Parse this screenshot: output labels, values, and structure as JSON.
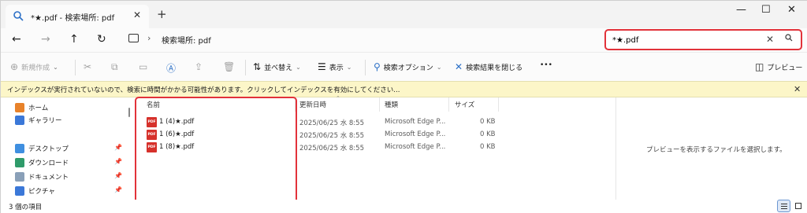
{
  "tab": {
    "title": "*★.pdf - 検索場所: pdf",
    "icon": "search-icon"
  },
  "window": {
    "new_tab": "+",
    "minimize": "—",
    "maximize": "☐",
    "close": "✕"
  },
  "address": {
    "crumb": "検索場所: pdf",
    "chevron": "›"
  },
  "search": {
    "value": "*★.pdf"
  },
  "toolbar": {
    "new_label": "新規作成",
    "sort_label": "並べ替え",
    "view_label": "表示",
    "search_options_label": "検索オプション",
    "close_search_label": "検索結果を閉じる",
    "more_label": "•••",
    "preview_label": "プレビュー"
  },
  "infobar": {
    "message": "インデックスが実行されていないので、検索に時間がかかる可能性があります。クリックしてインデックスを有効にしてください..."
  },
  "sidebar": {
    "items": [
      {
        "label": "ホーム",
        "icon": "home-icon",
        "color": "#e8822a"
      },
      {
        "label": "ギャラリー",
        "icon": "gallery-icon",
        "color": "#3b78d8"
      },
      {
        "label": "デスクトップ",
        "icon": "desktop-icon",
        "color": "#3f8fe0"
      },
      {
        "label": "ダウンロード",
        "icon": "download-icon",
        "color": "#2f9b6a"
      },
      {
        "label": "ドキュメント",
        "icon": "documents-icon",
        "color": "#8aa0b8"
      },
      {
        "label": "ピクチャ",
        "icon": "pictures-icon",
        "color": "#3b78d8"
      }
    ]
  },
  "columns": {
    "name": "名前",
    "date": "更新日時",
    "type": "種類",
    "size": "サイズ"
  },
  "files": [
    {
      "name": "1 (4)★.pdf",
      "date": "2025/06/25 水 8:55",
      "type": "Microsoft Edge P...",
      "size": "0 KB"
    },
    {
      "name": "1 (6)★.pdf",
      "date": "2025/06/25 水 8:55",
      "type": "Microsoft Edge P...",
      "size": "0 KB"
    },
    {
      "name": "1 (8)★.pdf",
      "date": "2025/06/25 水 8:55",
      "type": "Microsoft Edge P...",
      "size": "0 KB"
    }
  ],
  "preview": {
    "message": "プレビューを表示するファイルを選択します。"
  },
  "status": {
    "count": "3 個の項目"
  },
  "colors": {
    "highlight": "#e2323a",
    "infobar": "#fcf6c8",
    "pdf_icon": "#d6312b"
  }
}
